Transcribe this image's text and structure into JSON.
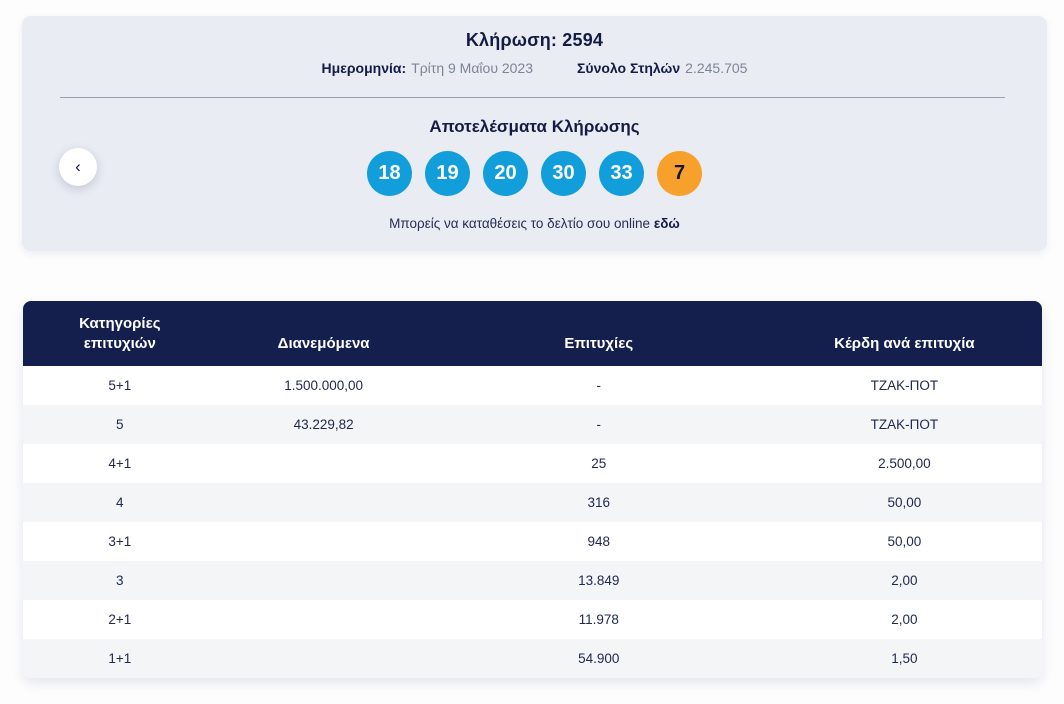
{
  "banner": {
    "title": "Κλήρωση: 2594",
    "date_label": "Ημερομηνία:",
    "date_value": "Τρίτη 9 Μαΐου 2023",
    "columns_label": "Σύνολο Στηλών",
    "columns_value": "2.245.705",
    "results_heading": "Αποτελέσματα Κλήρωσης",
    "numbers": [
      "18",
      "19",
      "20",
      "30",
      "33"
    ],
    "joker": "7",
    "footnote_text": "Μπορείς να καταθέσεις το δελτίο σου online",
    "footnote_link": "εδώ",
    "prev_arrow": "‹"
  },
  "colors": {
    "ball_blue": "#129edb",
    "ball_orange": "#f7a02b",
    "header_navy": "#141f4e",
    "banner_bg": "#e9ecf3",
    "alt_row_bg": "#f4f5f7"
  },
  "table": {
    "headers": [
      "Κατηγορίες επιτυχιών",
      "Διανεμόμενα",
      "Επιτυχίες",
      "Κέρδη ανά επιτυχία"
    ],
    "rows": [
      {
        "category": "5+1",
        "distributed": "1.500.000,00",
        "winners": "-",
        "prize": "ΤΖΑΚ-ΠΟΤ"
      },
      {
        "category": "5",
        "distributed": "43.229,82",
        "winners": "-",
        "prize": "ΤΖΑΚ-ΠΟΤ"
      },
      {
        "category": "4+1",
        "distributed": "",
        "winners": "25",
        "prize": "2.500,00"
      },
      {
        "category": "4",
        "distributed": "",
        "winners": "316",
        "prize": "50,00"
      },
      {
        "category": "3+1",
        "distributed": "",
        "winners": "948",
        "prize": "50,00"
      },
      {
        "category": "3",
        "distributed": "",
        "winners": "13.849",
        "prize": "2,00"
      },
      {
        "category": "2+1",
        "distributed": "",
        "winners": "11.978",
        "prize": "2,00"
      },
      {
        "category": "1+1",
        "distributed": "",
        "winners": "54.900",
        "prize": "1,50"
      }
    ]
  }
}
